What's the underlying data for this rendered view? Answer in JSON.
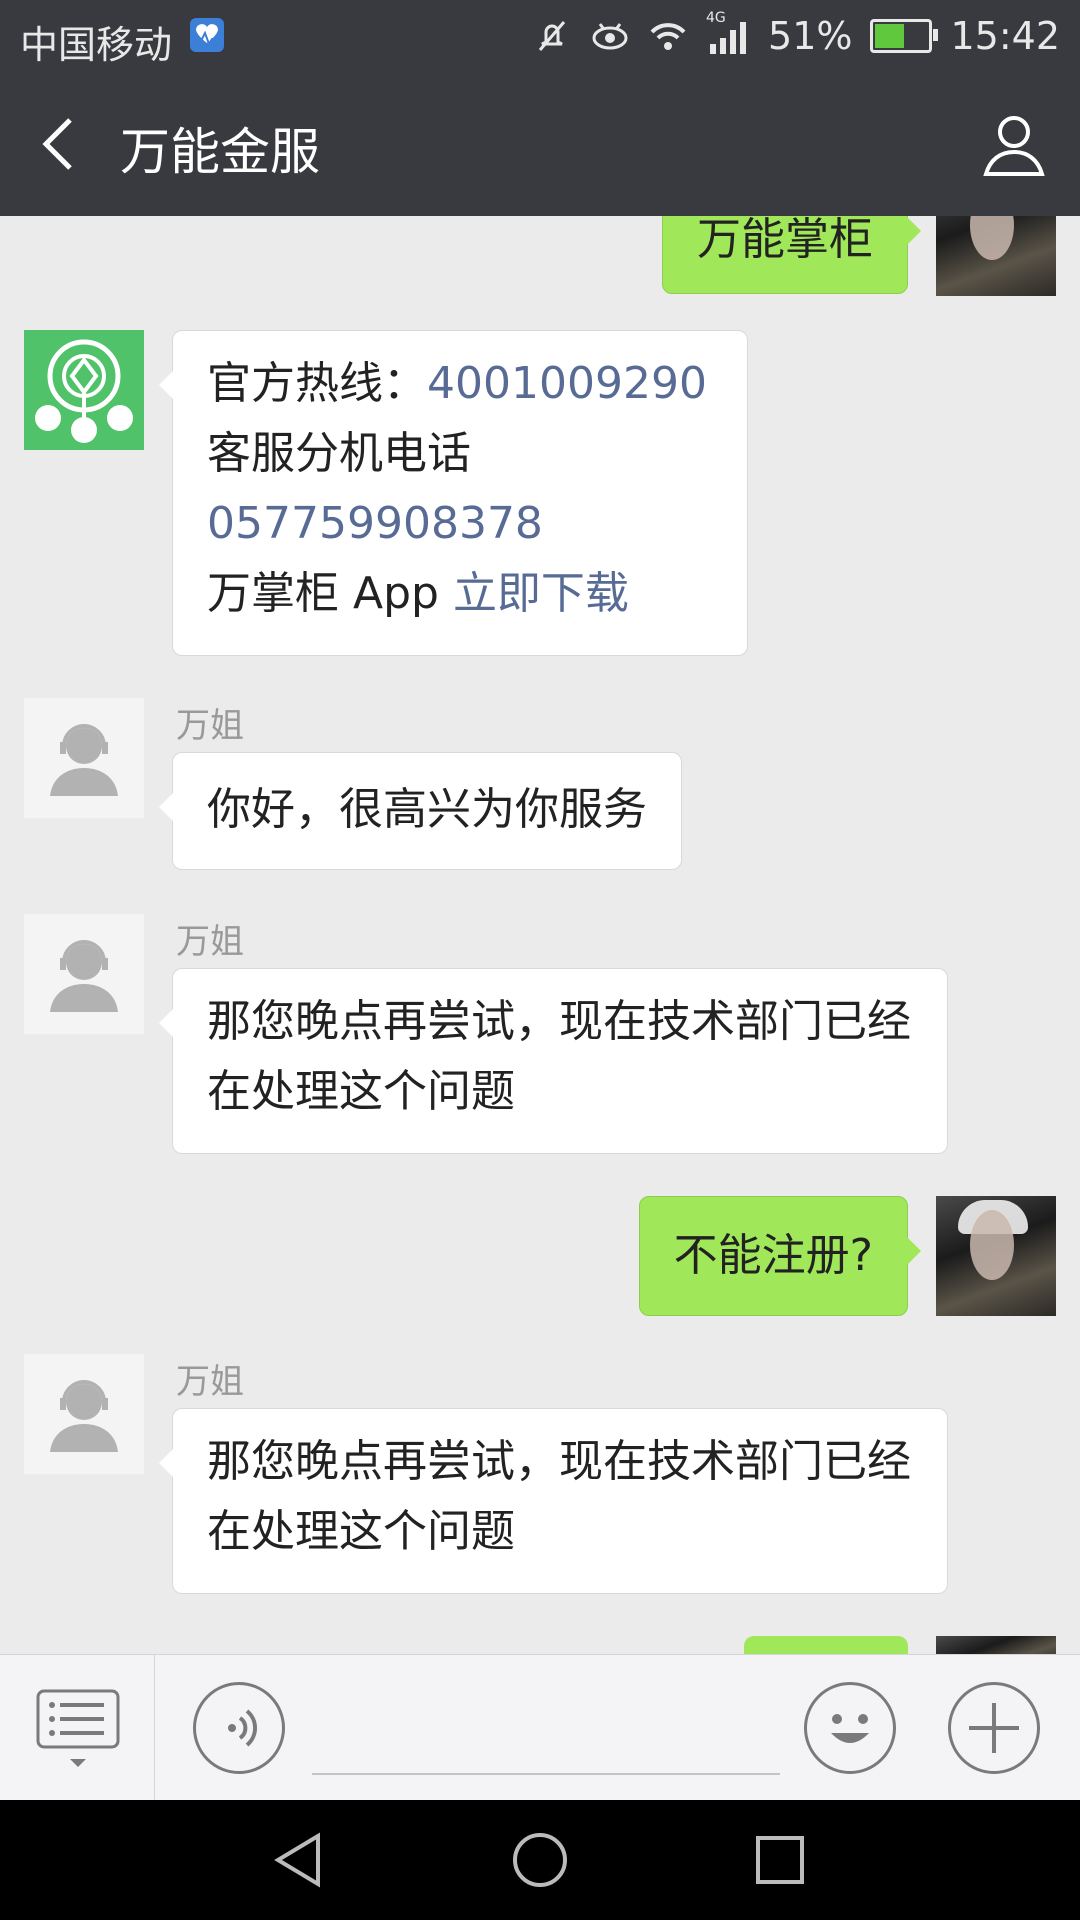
{
  "status_bar": {
    "carrier": "中国移动",
    "network": "4G",
    "battery_percent": "51%",
    "time": "15:42",
    "icons": [
      "health-app-icon",
      "mute-icon",
      "eye-comfort-icon",
      "wifi-icon",
      "signal-icon",
      "battery-icon"
    ]
  },
  "header": {
    "title": "万能金服",
    "icons": [
      "back-arrow-icon",
      "profile-icon"
    ]
  },
  "messages": [
    {
      "direction": "out",
      "text": "万能掌柜"
    },
    {
      "direction": "in",
      "sender": "",
      "lines": [
        {
          "text": "官方热线：",
          "link": "4001009290"
        },
        {
          "text": "客服分机电话",
          "link": ""
        },
        {
          "text": "",
          "link": "057759908378"
        },
        {
          "text": "万掌柜 App ",
          "link": "立即下载"
        }
      ]
    },
    {
      "direction": "in",
      "sender": "万姐",
      "text": "你好，很高兴为你服务"
    },
    {
      "direction": "in",
      "sender": "万姐",
      "text": "那您晚点再尝试，现在技术部门已经在处理这个问题"
    },
    {
      "direction": "out",
      "text": "不能注册?"
    },
    {
      "direction": "in",
      "sender": "万姐",
      "text": "那您晚点再尝试，现在技术部门已经在处理这个问题"
    }
  ],
  "input_bar": {
    "icons": [
      "menu-list-icon",
      "voice-icon",
      "emoji-icon",
      "plus-icon"
    ]
  },
  "nav_bar": {
    "icons": [
      "nav-back-icon",
      "nav-home-icon",
      "nav-recents-icon"
    ]
  },
  "colors": {
    "header_bg": "#393a3f",
    "chat_bg": "#ebebeb",
    "out_bubble": "#a0e75a",
    "link": "#576b95"
  }
}
